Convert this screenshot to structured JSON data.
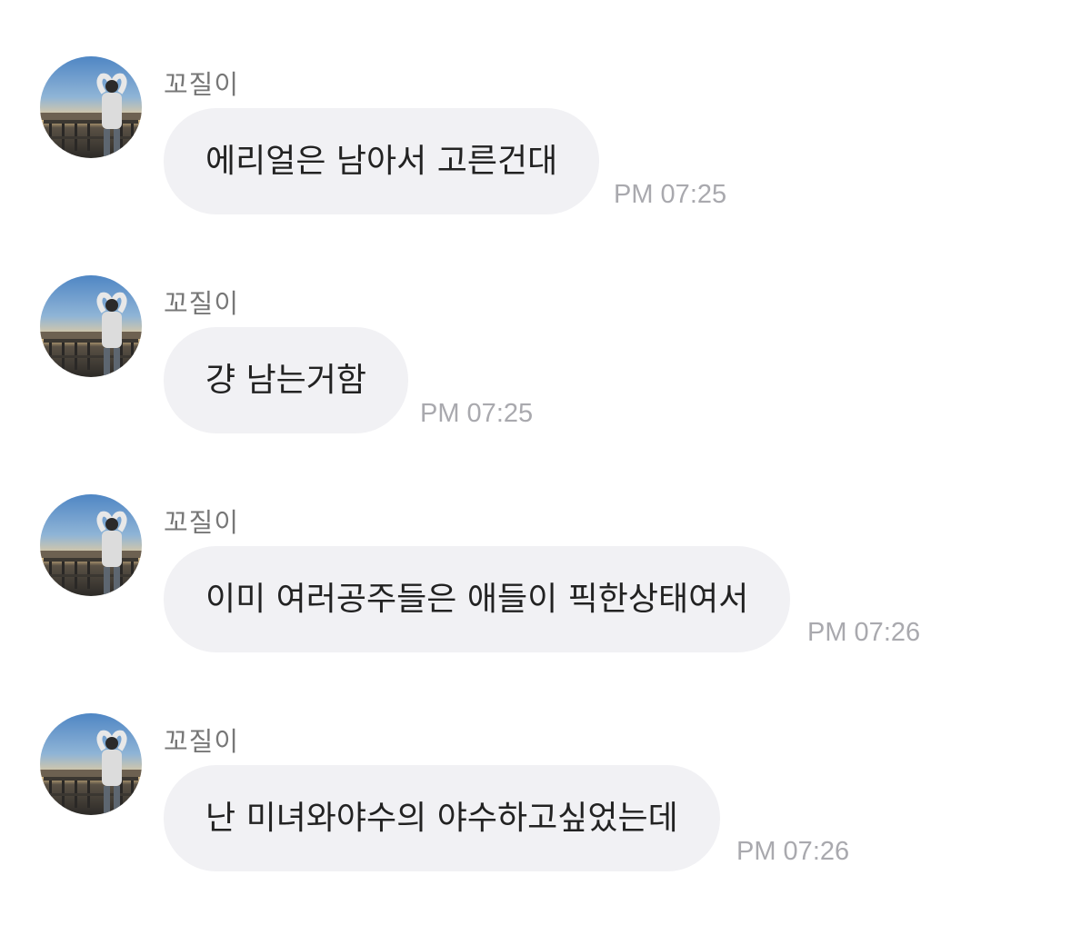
{
  "messages": [
    {
      "sender": "꼬질이",
      "text": "에리얼은 남아서 고른건대",
      "time": "PM 07:25",
      "avatar": "profile-photo-avatar"
    },
    {
      "sender": "꼬질이",
      "text": "걍 남는거함",
      "time": "PM 07:25",
      "avatar": "profile-photo-avatar"
    },
    {
      "sender": "꼬질이",
      "text": "이미 여러공주들은 애들이 픽한상태여서",
      "time": "PM 07:26",
      "avatar": "profile-photo-avatar"
    },
    {
      "sender": "꼬질이",
      "text": "난 미녀와야수의 야수하고싶었는데",
      "time": "PM 07:26",
      "avatar": "profile-photo-avatar"
    }
  ],
  "colors": {
    "bubble": "#f1f1f4",
    "sender": "#777777",
    "time": "#a9a9ae",
    "text": "#222222",
    "background": "#ffffff"
  }
}
